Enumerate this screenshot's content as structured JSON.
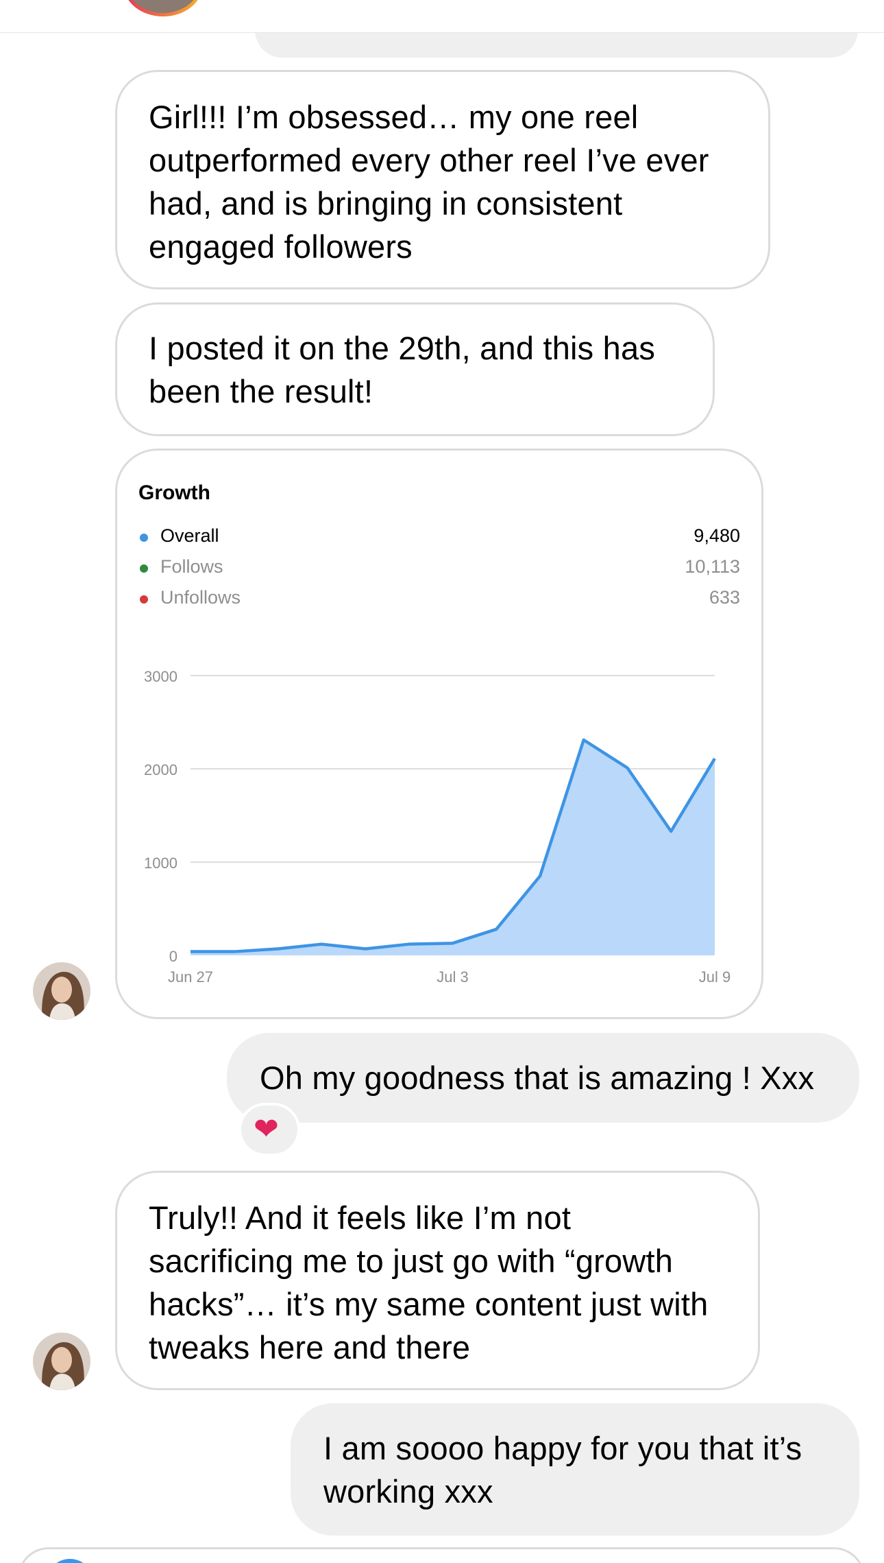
{
  "thread": {
    "messages": [
      {
        "id": "m1",
        "side": "in",
        "text": "Girl!!! I’m obsessed… my one reel outperformed every other reel I’ve ever had, and is bringing in consistent engaged followers"
      },
      {
        "id": "m2",
        "side": "in",
        "text": "I posted it on the 29th, and this has been the result!"
      },
      {
        "id": "m3",
        "side": "out",
        "text": "Oh my goodness that is amazing ! Xxx",
        "reaction": "❤️"
      },
      {
        "id": "m4",
        "side": "in",
        "text": "Truly!! And it feels like I’m not sacrificing me to just go with “growth hacks”… it’s my same content just with tweaks here and there"
      },
      {
        "id": "m5",
        "side": "out",
        "text": "I am soooo happy for you that it’s working xxx"
      }
    ],
    "lines": {
      "m1": [
        "Girl!!! I’m obsessed… my one reel",
        "outperformed every other reel I’ve ever",
        "had, and is bringing in consistent",
        "engaged followers"
      ],
      "m2": [
        "I posted it on the 29th, and this has",
        "been the result!"
      ],
      "m3": [
        "Oh my goodness that is amazing ! Xxx"
      ],
      "m4": [
        "Truly!! And it feels like I’m not",
        "sacrificing me to just go with “growth",
        "hacks”… it’s my same content just with",
        "tweaks here and there"
      ],
      "m5": [
        "I am soooo happy for you that it’s",
        "working xxx"
      ]
    }
  },
  "growth_card": {
    "title": "Growth",
    "legend": [
      {
        "label": "Overall",
        "value": "9,480",
        "color": "#3f94e3",
        "text_color": "#000000"
      },
      {
        "label": "Follows",
        "value": "10,113",
        "color": "#2e8a3e",
        "text_color": "#8e8e8e"
      },
      {
        "label": "Unfollows",
        "value": "633",
        "color": "#d63a3a",
        "text_color": "#8e8e8e"
      }
    ]
  },
  "chart_data": {
    "type": "area",
    "title": "Growth",
    "x": [
      "Jun 27",
      "Jun 28",
      "Jun 29",
      "Jun 30",
      "Jul 1",
      "Jul 2",
      "Jul 3",
      "Jul 4",
      "Jul 5",
      "Jul 6",
      "Jul 7",
      "Jul 8",
      "Jul 9"
    ],
    "x_tick_labels": [
      "Jun 27",
      "Jul 3",
      "Jul 9"
    ],
    "y_ticks": [
      0,
      1000,
      2000,
      3000
    ],
    "ylim": [
      0,
      3000
    ],
    "series": [
      {
        "name": "Overall",
        "values": [
          40,
          40,
          70,
          120,
          70,
          120,
          130,
          280,
          850,
          2310,
          2010,
          1330,
          2110
        ]
      }
    ],
    "line_color": "#3f94e3",
    "fill_color": "#b9d8fa",
    "grid": true
  }
}
